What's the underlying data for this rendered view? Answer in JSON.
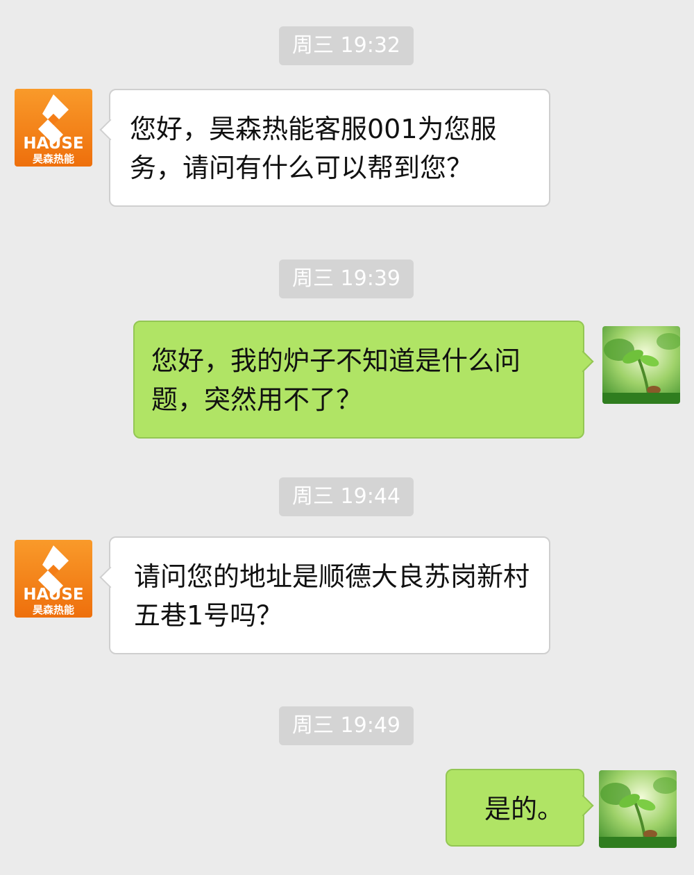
{
  "colors": {
    "background": "#ebebeb",
    "time_pill": "#d4d4d4",
    "incoming_bubble": "#ffffff",
    "outgoing_bubble": "#b0e465",
    "brand_orange": "#f47d16"
  },
  "messages": [
    {
      "timestamp": "周三 19:32",
      "direction": "incoming",
      "sender_avatar": "hause-logo-icon",
      "text": "您好，昊森热能客服001为您服务，请问有什么可以帮到您？"
    },
    {
      "timestamp": "周三 19:39",
      "direction": "outgoing",
      "sender_avatar": "sprout-photo-icon",
      "text": "您好，我的炉子不知道是什么问题，突然用不了？"
    },
    {
      "timestamp": "周三 19:44",
      "direction": "incoming",
      "sender_avatar": "hause-logo-icon",
      "text": "请问您的地址是顺德大良苏岗新村五巷1号吗？"
    },
    {
      "timestamp": "周三 19:49",
      "direction": "outgoing",
      "sender_avatar": "sprout-photo-icon",
      "text": "是的。"
    }
  ],
  "logo": {
    "brand": "HAUSE",
    "brand_cn": "昊森热能"
  }
}
